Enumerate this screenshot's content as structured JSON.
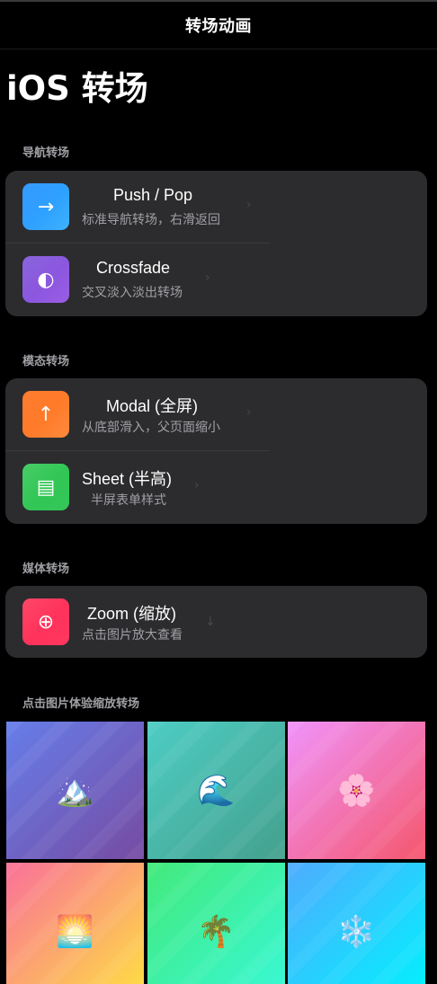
{
  "navbar": {
    "title": "转场动画"
  },
  "large_title": "iOS 转场",
  "sections": [
    {
      "header": "导航转场",
      "rows": [
        {
          "title": "Push / Pop",
          "subtitle": "标准导航转场，右滑返回",
          "icon": "arrow-right-icon",
          "glyph": "→",
          "chevron": "›"
        },
        {
          "title": "Crossfade",
          "subtitle": "交叉淡入淡出转场",
          "icon": "half-circle-icon",
          "glyph": "◐",
          "chevron": "›"
        }
      ]
    },
    {
      "header": "模态转场",
      "rows": [
        {
          "title": "Modal (全屏)",
          "subtitle": "从底部滑入，父页面缩小",
          "icon": "arrow-up-icon",
          "glyph": "↑",
          "chevron": "›"
        },
        {
          "title": "Sheet (半高)",
          "subtitle": "半屏表单样式",
          "icon": "sheet-icon",
          "glyph": "▤",
          "chevron": "›"
        }
      ]
    },
    {
      "header": "媒体转场",
      "rows": [
        {
          "title": "Zoom (缩放)",
          "subtitle": "点击图片放大查看",
          "icon": "crosshair-circle-icon",
          "glyph": "⊕",
          "chevron": "↓"
        }
      ]
    }
  ],
  "gallery": {
    "header": "点击图片体验缩放转场",
    "photos": [
      {
        "name": "mountain",
        "emoji": "🏔️",
        "icon": "mountain-icon",
        "colors": [
          "#667eea",
          "#764ba2"
        ]
      },
      {
        "name": "wave",
        "emoji": "🌊",
        "icon": "wave-icon",
        "colors": [
          "#4ecdc4",
          "#44a08d"
        ]
      },
      {
        "name": "flower",
        "emoji": "🌸",
        "icon": "flower-icon",
        "colors": [
          "#f093fb",
          "#f5576c"
        ]
      },
      {
        "name": "sunrise",
        "emoji": "🌅",
        "icon": "sunrise-icon",
        "colors": [
          "#fa709a",
          "#fee140"
        ]
      },
      {
        "name": "palm",
        "emoji": "🌴",
        "icon": "palm-tree-icon",
        "colors": [
          "#43e97b",
          "#38f9d7"
        ]
      },
      {
        "name": "snowflake",
        "emoji": "❄️",
        "icon": "snowflake-icon",
        "colors": [
          "#4facfe",
          "#00f2fe"
        ]
      }
    ]
  },
  "colors": {
    "background": "#000000",
    "group_background": "#2c2c2e",
    "secondary_text": "#a0a0a5",
    "icon_push": [
      "#1a8cff",
      "#3fb2ff"
    ],
    "icon_crossfade": [
      "#7a4fd8",
      "#9b5de5"
    ],
    "icon_modal": [
      "#ff6a13",
      "#ff8a3d"
    ],
    "icon_sheet": [
      "#2fc552",
      "#34c759"
    ],
    "icon_zoom": [
      "#ff2d55",
      "#ff375f"
    ]
  }
}
